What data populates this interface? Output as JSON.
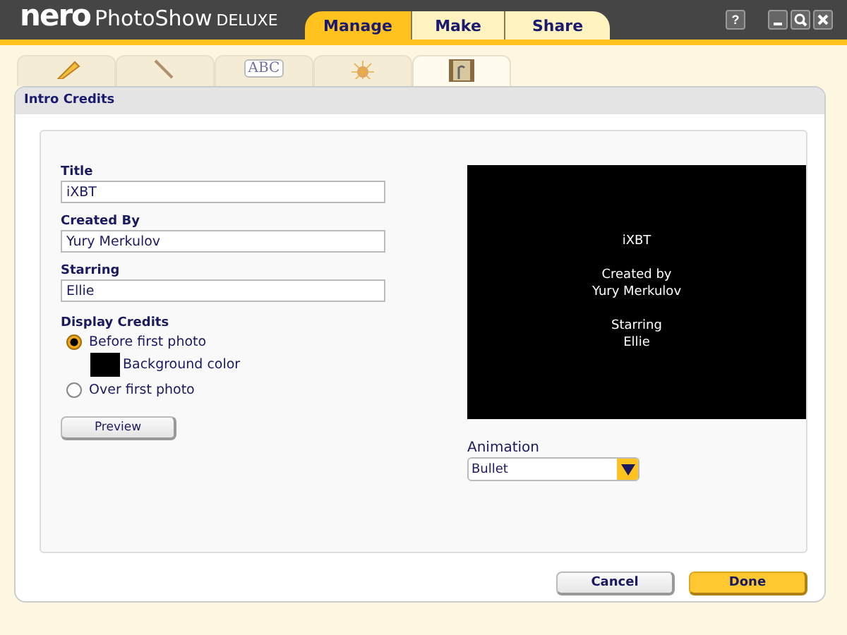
{
  "app": {
    "brand": "nero",
    "product": "PhotoShow",
    "edition": "DELUXE"
  },
  "main_tabs": [
    {
      "label": "Manage",
      "selected": true
    },
    {
      "label": "Make",
      "selected": false
    },
    {
      "label": "Share",
      "selected": false
    }
  ],
  "window_buttons": [
    {
      "kind": "help",
      "label": "?"
    },
    {
      "kind": "minimize"
    },
    {
      "kind": "zoom"
    },
    {
      "kind": "close"
    }
  ],
  "tool_tabs": [
    {
      "kind": "pencil",
      "selected": false
    },
    {
      "kind": "brush",
      "selected": false
    },
    {
      "kind": "text",
      "label": "ABC",
      "selected": false
    },
    {
      "kind": "sparkle",
      "selected": false
    },
    {
      "kind": "film",
      "selected": true
    }
  ],
  "dialog": {
    "title": "Intro Credits",
    "fields": [
      {
        "label": "Title",
        "value": "iXBT"
      },
      {
        "label": "Created By",
        "value": "Yury Merkulov"
      },
      {
        "label": "Starring",
        "value": "Ellie"
      }
    ],
    "display_credits": {
      "label": "Display Credits",
      "options": [
        {
          "label": "Before first photo",
          "selected": true,
          "color_label": "Background color",
          "color": "#000000"
        },
        {
          "label": "Over first photo",
          "selected": false
        }
      ]
    },
    "preview_button": "Preview",
    "preview_lines": [
      "iXBT",
      "Created by",
      "Yury Merkulov",
      "Starring",
      "Ellie"
    ],
    "animation": {
      "label": "Animation",
      "value": "Bullet"
    },
    "buttons": [
      {
        "label": "Cancel",
        "kind": "secondary"
      },
      {
        "label": "Done",
        "kind": "primary"
      }
    ]
  }
}
